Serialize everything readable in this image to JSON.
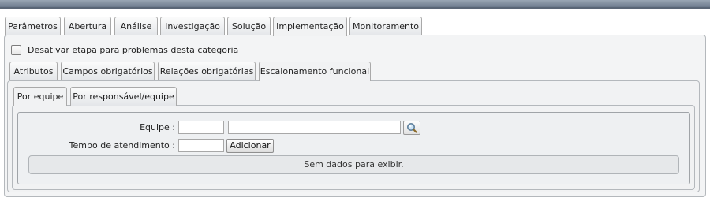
{
  "main_tabs": [
    {
      "label": "Parâmetros",
      "active": false
    },
    {
      "label": "Abertura",
      "active": false
    },
    {
      "label": "Análise",
      "active": false
    },
    {
      "label": "Investigação",
      "active": false
    },
    {
      "label": "Solução",
      "active": false
    },
    {
      "label": "Implementação",
      "active": true
    },
    {
      "label": "Monitoramento",
      "active": false
    }
  ],
  "options": {
    "disable_step_label": "Desativar etapa para problemas desta categoria",
    "disable_step_checked": false
  },
  "sub_tabs": [
    {
      "label": "Atributos",
      "active": false
    },
    {
      "label": "Campos obrigatórios",
      "active": false
    },
    {
      "label": "Relações obrigatórias",
      "active": false
    },
    {
      "label": "Escalonamento funcional",
      "active": true
    }
  ],
  "inner_tabs": [
    {
      "label": "Por equipe",
      "active": true
    },
    {
      "label": "Por responsável/equipe",
      "active": false
    }
  ],
  "form": {
    "team_label": "Equipe :",
    "team_code_value": "",
    "team_name_value": "",
    "time_label": "Tempo de atendimento :",
    "time_value": "",
    "add_button": "Adicionar"
  },
  "grid": {
    "empty_message": "Sem dados para exibir."
  },
  "icons": {
    "search_button": "magnifier-icon"
  },
  "colors": {
    "top_bar": "#6c7a8c",
    "panel_background": "#f1f2f3",
    "border": "#b4b8bc"
  }
}
